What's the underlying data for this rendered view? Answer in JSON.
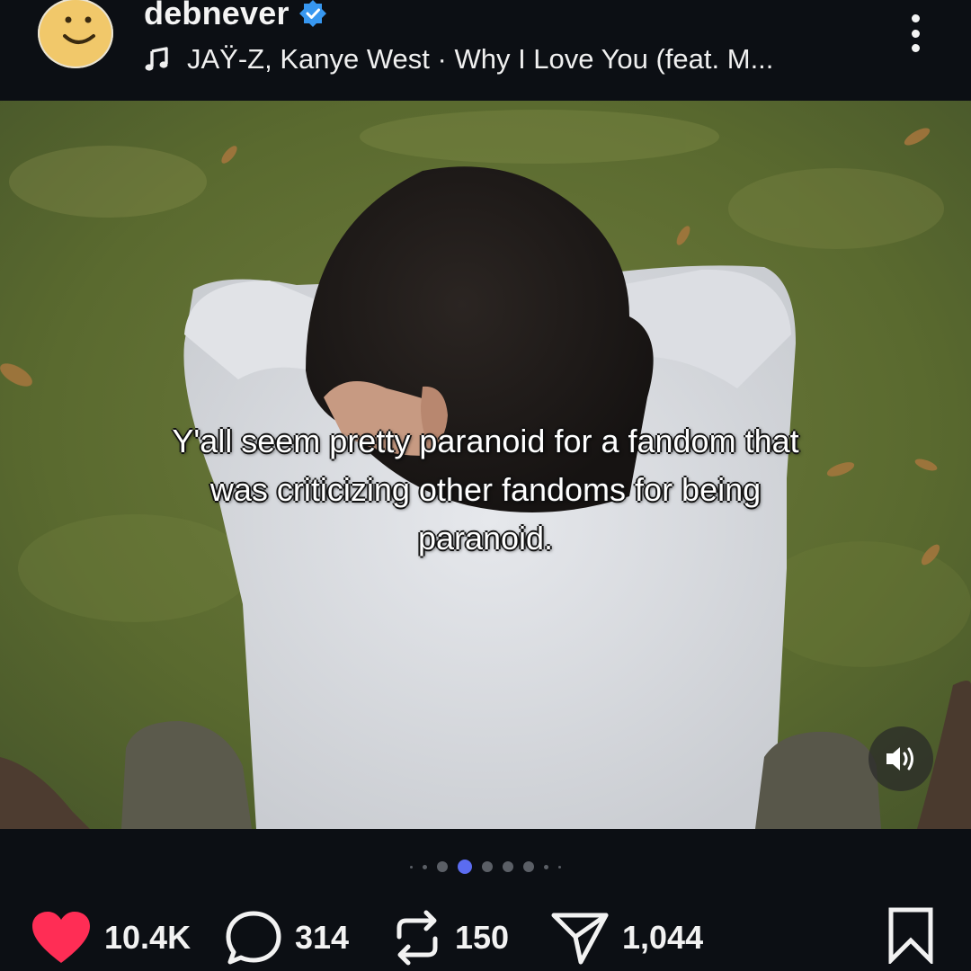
{
  "header": {
    "username": "debnever",
    "verified": true,
    "music_track": "JAŸ-Z, Kanye West · Why I Love You (feat. M..."
  },
  "media": {
    "caption": "Y'all seem pretty paranoid for a fandom that was criticizing other fandoms for being paranoid.",
    "carousel": {
      "total": 9,
      "active_index": 3
    }
  },
  "actions": {
    "likes": "10.4K",
    "comments": "314",
    "reposts": "150",
    "shares": "1,044"
  },
  "colors": {
    "background": "#0c0f14",
    "like": "#ff2d55",
    "verified": "#3797f0",
    "active_dot": "#5b6cf0"
  },
  "icons": [
    "smiley-avatar-icon",
    "verified-icon",
    "music-note-icon",
    "more-options-icon",
    "speaker-icon",
    "heart-icon",
    "comment-icon",
    "repost-icon",
    "share-icon",
    "bookmark-icon"
  ]
}
